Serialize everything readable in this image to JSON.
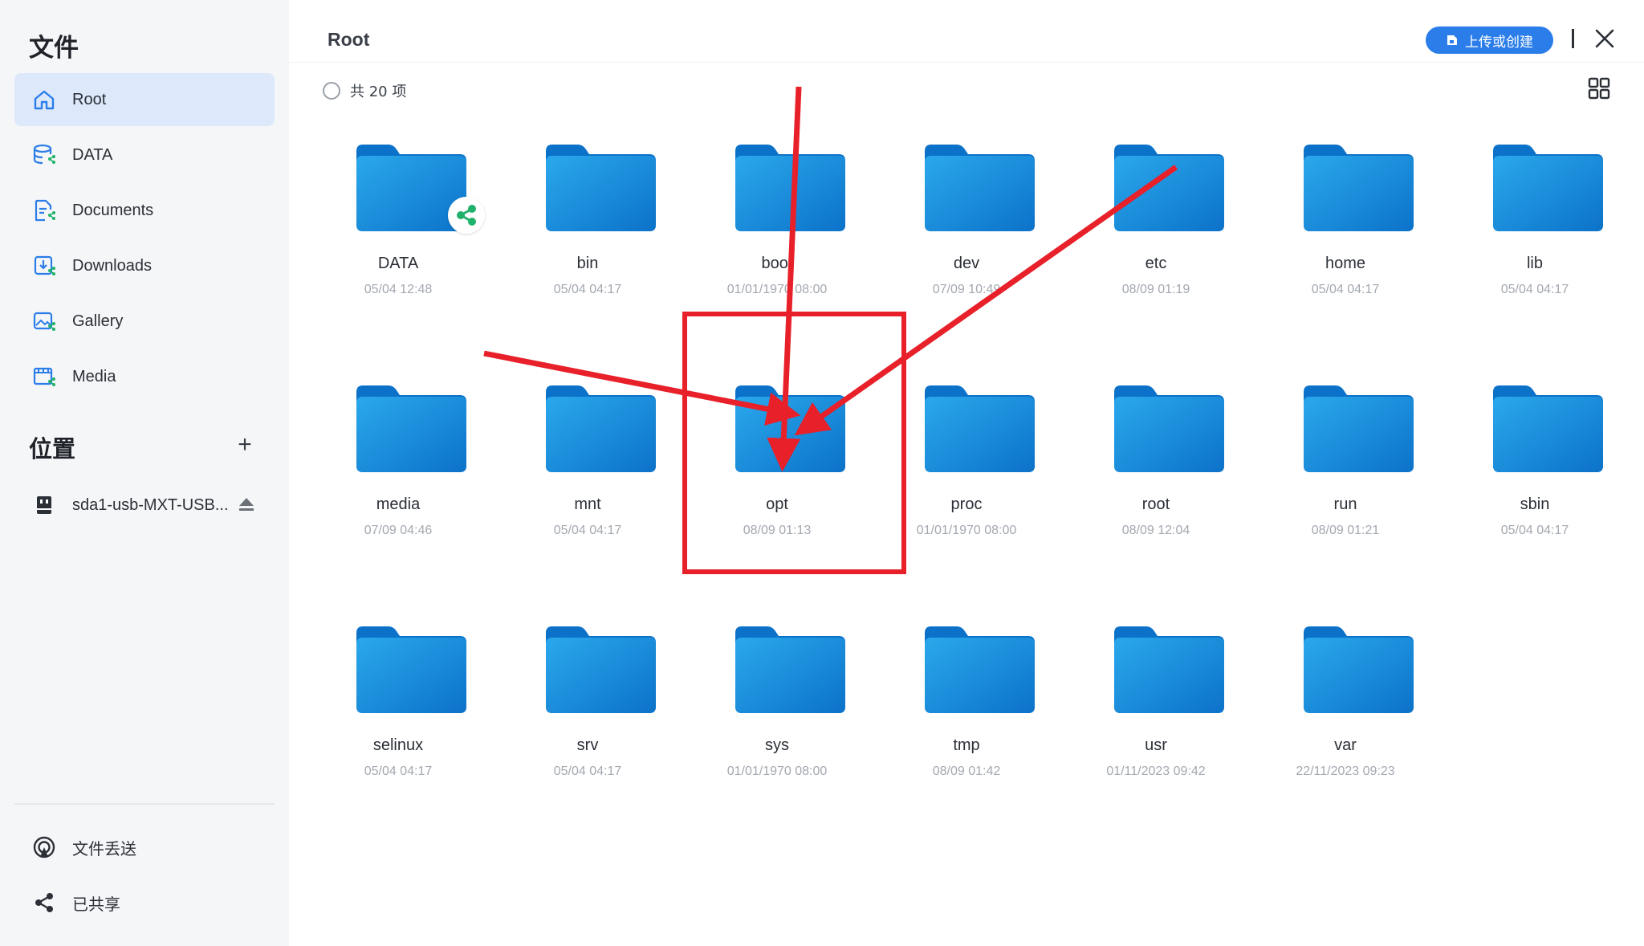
{
  "sidebar": {
    "title": "文件",
    "items": [
      {
        "label": "Root",
        "icon": "home-icon",
        "active": true
      },
      {
        "label": "DATA",
        "icon": "database-share-icon",
        "active": false
      },
      {
        "label": "Documents",
        "icon": "document-share-icon",
        "active": false
      },
      {
        "label": "Downloads",
        "icon": "download-share-icon",
        "active": false
      },
      {
        "label": "Gallery",
        "icon": "image-share-icon",
        "active": false
      },
      {
        "label": "Media",
        "icon": "film-share-icon",
        "active": false
      }
    ],
    "locations_title": "位置",
    "add_location_symbol": "+",
    "location": {
      "label": "sda1-usb-MXT-USB...",
      "icon": "usb-drive-icon"
    },
    "bottom_items": [
      {
        "label": "文件丢送",
        "icon": "airdrop-icon"
      },
      {
        "label": "已共享",
        "icon": "share-icon"
      }
    ]
  },
  "header": {
    "title": "Root",
    "upload_label": "上传或创建",
    "close_icon": "close-icon"
  },
  "toolbar": {
    "count_label": "共 20 项",
    "view_icon": "grid-view-icon"
  },
  "files": [
    {
      "name": "DATA",
      "date": "05/04 12:48",
      "shared": true
    },
    {
      "name": "bin",
      "date": "05/04 04:17"
    },
    {
      "name": "boot",
      "date": "01/01/1970 08:00"
    },
    {
      "name": "dev",
      "date": "07/09 10:49"
    },
    {
      "name": "etc",
      "date": "08/09 01:19"
    },
    {
      "name": "home",
      "date": "05/04 04:17"
    },
    {
      "name": "lib",
      "date": "05/04 04:17"
    },
    {
      "name": "media",
      "date": "07/09 04:46"
    },
    {
      "name": "mnt",
      "date": "05/04 04:17"
    },
    {
      "name": "opt",
      "date": "08/09 01:13",
      "highlighted": true
    },
    {
      "name": "proc",
      "date": "01/01/1970 08:00"
    },
    {
      "name": "root",
      "date": "08/09 12:04"
    },
    {
      "name": "run",
      "date": "08/09 01:21"
    },
    {
      "name": "sbin",
      "date": "05/04 04:17"
    },
    {
      "name": "selinux",
      "date": "05/04 04:17"
    },
    {
      "name": "srv",
      "date": "05/04 04:17"
    },
    {
      "name": "sys",
      "date": "01/01/1970 08:00"
    },
    {
      "name": "tmp",
      "date": "08/09 01:42"
    },
    {
      "name": "usr",
      "date": "01/11/2023 09:42"
    },
    {
      "name": "var",
      "date": "22/11/2023 09:23"
    }
  ],
  "colors": {
    "accent": "#2b7de9",
    "sidebar_active": "#dde9fb",
    "folder_front": "#1e9be6",
    "folder_back": "#0c72c9",
    "annotation": "#e8202a",
    "share_badge": "#20b26b"
  }
}
